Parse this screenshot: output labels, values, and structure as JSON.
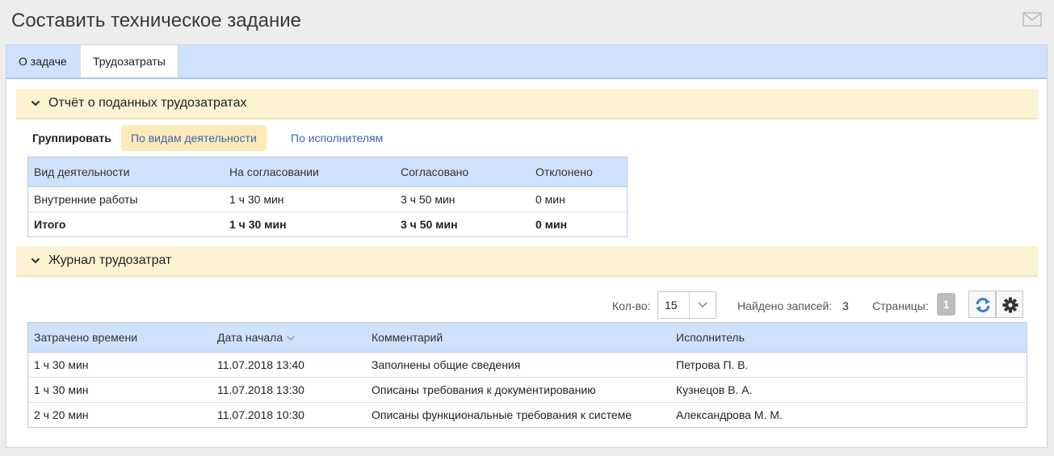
{
  "header": {
    "title": "Составить техническое задание",
    "mail_icon": "envelope-icon"
  },
  "tabs": [
    {
      "label": "О задаче",
      "active": false
    },
    {
      "label": "Трудозатраты",
      "active": true
    }
  ],
  "report": {
    "title": "Отчёт о поданных трудозатратах",
    "group_label": "Группировать",
    "group_options": [
      {
        "label": "По видам деятельности",
        "active": true
      },
      {
        "label": "По исполнителям",
        "active": false
      }
    ],
    "columns": [
      "Вид деятельности",
      "На согласовании",
      "Согласовано",
      "Отклонено"
    ],
    "rows": [
      {
        "activity": "Внутренние работы",
        "pending": "1 ч 30 мин",
        "approved": "3 ч 50 мин",
        "rejected": "0 мин"
      }
    ],
    "total": {
      "activity": "Итого",
      "pending": "1 ч 30 мин",
      "approved": "3 ч 50 мин",
      "rejected": "0 мин"
    }
  },
  "journal": {
    "title": "Журнал трудозатрат",
    "qty_label": "Кол-во:",
    "qty_value": "15",
    "found_label": "Найдено записей:",
    "found_value": "3",
    "pages_label": "Страницы:",
    "page_current": "1",
    "columns": [
      "Затрачено времени",
      "Дата начала",
      "Комментарий",
      "Исполнитель"
    ],
    "rows": [
      {
        "spent": "1 ч 30 мин",
        "start": "11.07.2018 13:40",
        "comment": "Заполнены общие сведения",
        "executor": "Петрова П. В."
      },
      {
        "spent": "1 ч 30 мин",
        "start": "11.07.2018 13:30",
        "comment": "Описаны требования к документированию",
        "executor": "Кузнецов В. А."
      },
      {
        "spent": "2 ч 20 мин",
        "start": "11.07.2018 10:30",
        "comment": "Описаны функциональные требования к системе",
        "executor": "Александрова М. М."
      }
    ]
  },
  "colors": {
    "approved": "#2d8a2d",
    "rejected": "#e02020",
    "link": "#3f63b3",
    "tab_bar": "#cfe1fb",
    "section_bg": "#fdf3d3"
  }
}
